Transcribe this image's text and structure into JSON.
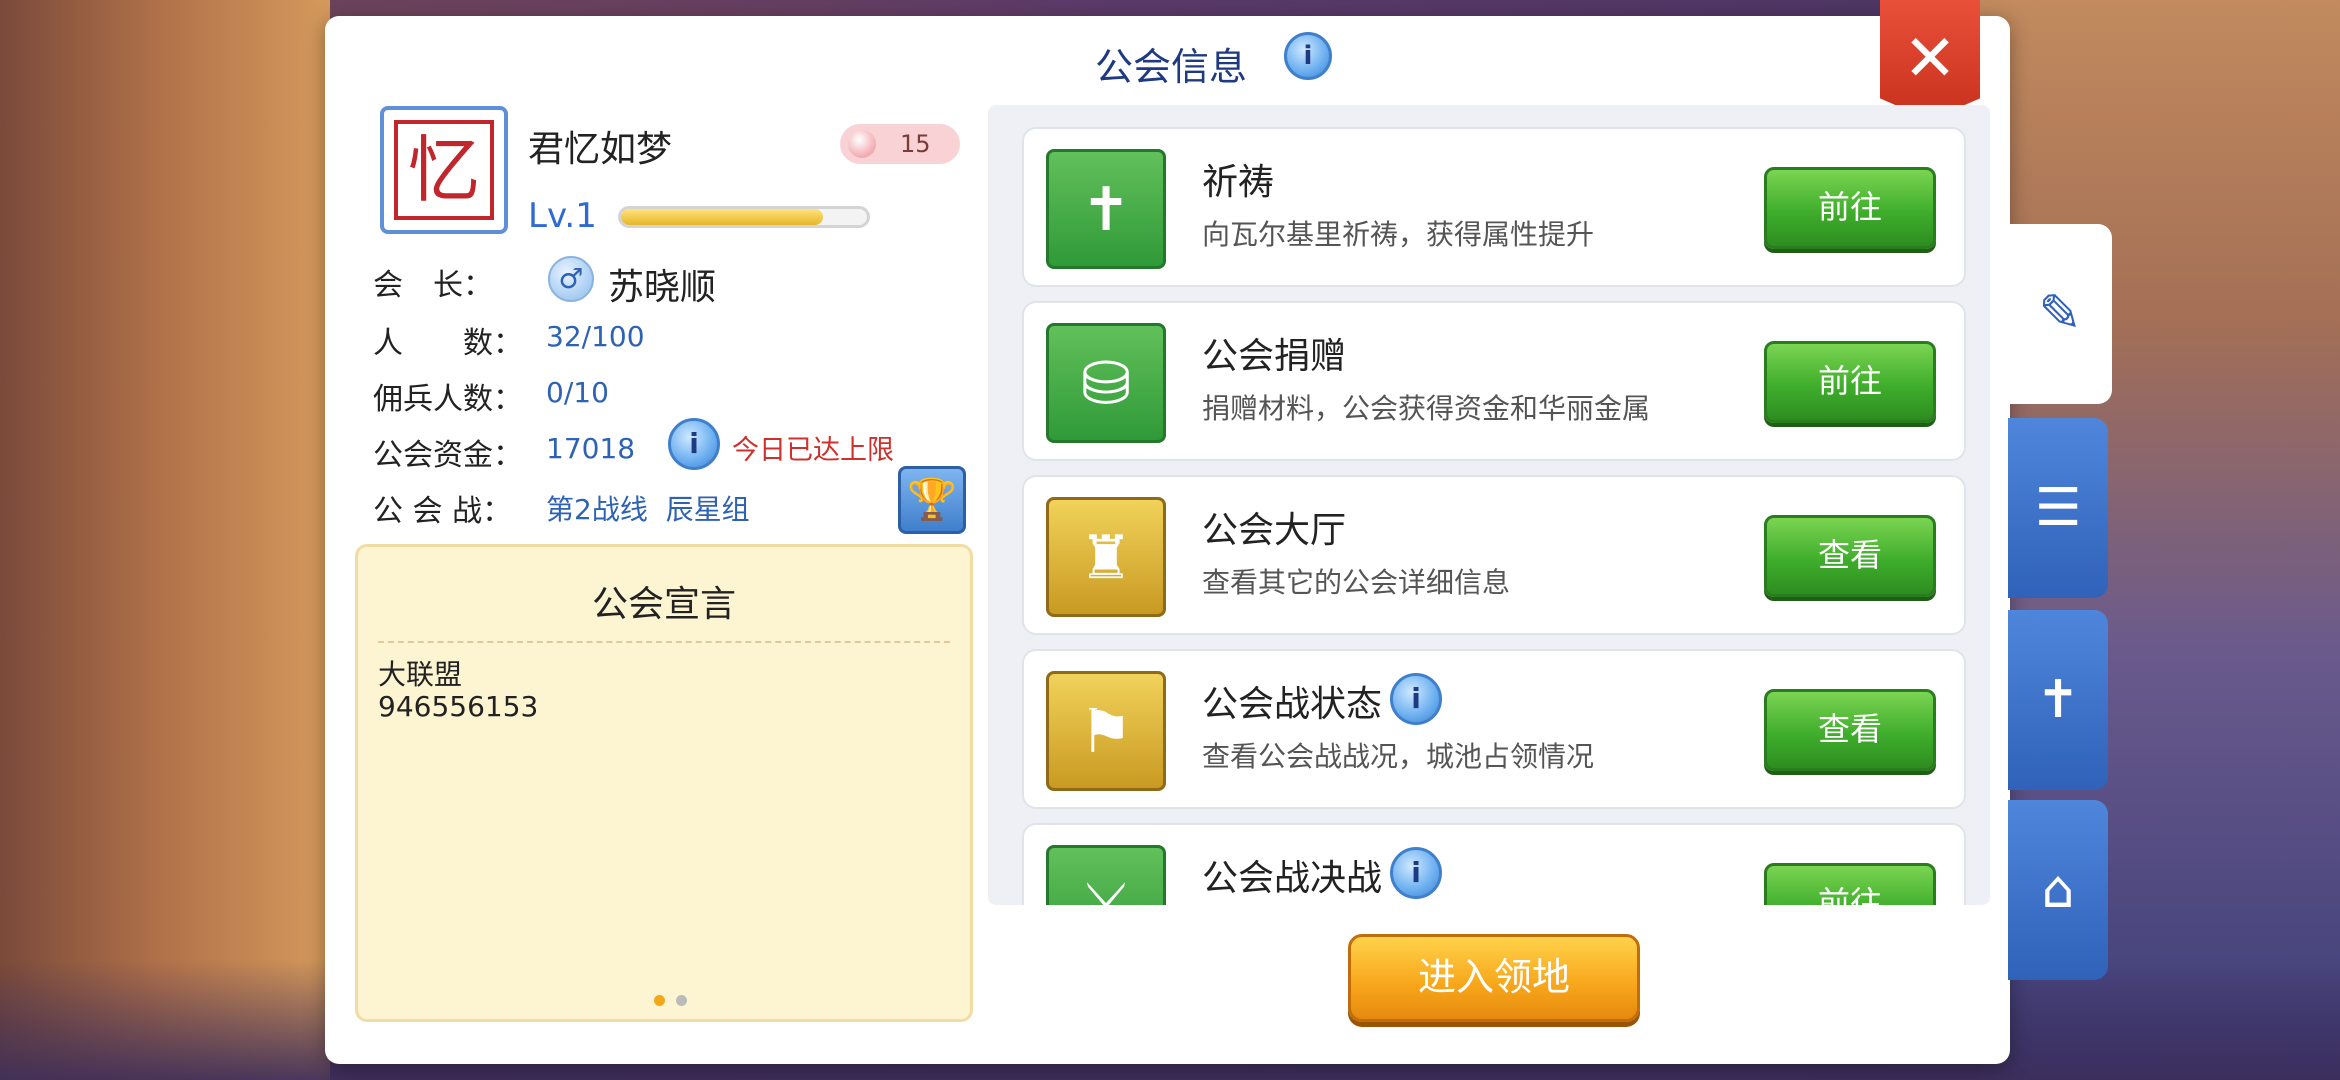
{
  "panel": {
    "title": "公会信息",
    "close_label": "✕"
  },
  "guild": {
    "emblem_char": "忆",
    "name": "君忆如梦",
    "badge_count": "15",
    "level": "Lv.1",
    "xp_fraction": 0.82,
    "leader_label": "会　长：",
    "leader_gender": "♂",
    "leader_name": "苏晓顺",
    "members_label": "人　　数：",
    "members_value": "32/100",
    "mercenary_label": "佣兵人数：",
    "mercenary_value": "0/10",
    "funds_label": "公会资金：",
    "funds_value": "17018",
    "funds_limit_text": "今日已达上限",
    "war_label": "公 会 战：",
    "war_value": "第2战线  辰星组"
  },
  "manifesto": {
    "title": "公会宣言",
    "text": "大联盟\n946556153"
  },
  "activities": [
    {
      "title": "祈祷",
      "desc": "向瓦尔基里祈祷，获得属性提升",
      "button": "前往",
      "icon": "prayer-icon"
    },
    {
      "title": "公会捐赠",
      "desc": "捐赠材料，公会获得资金和华丽金属",
      "button": "前往",
      "icon": "donation-icon"
    },
    {
      "title": "公会大厅",
      "desc": "查看其它的公会详细信息",
      "button": "查看",
      "icon": "castle-icon"
    },
    {
      "title": "公会战状态",
      "desc": "查看公会战战况，城池占领情况",
      "button": "查看",
      "icon": "fortress-flag-icon"
    },
    {
      "title": "公会战决战",
      "desc": "",
      "button": "前往",
      "icon": "crossed-swords-icon"
    }
  ],
  "enter_button": "进入领地",
  "side_tabs": [
    "edit-icon",
    "member-list-icon",
    "chapel-icon",
    "guild-home-icon"
  ],
  "colors": {
    "title_blue": "#1f3a80",
    "button_green": "#3fae2c",
    "enter_orange": "#f7a51a",
    "tab_blue": "#2f62b8",
    "limit_red": "#d0302c"
  }
}
